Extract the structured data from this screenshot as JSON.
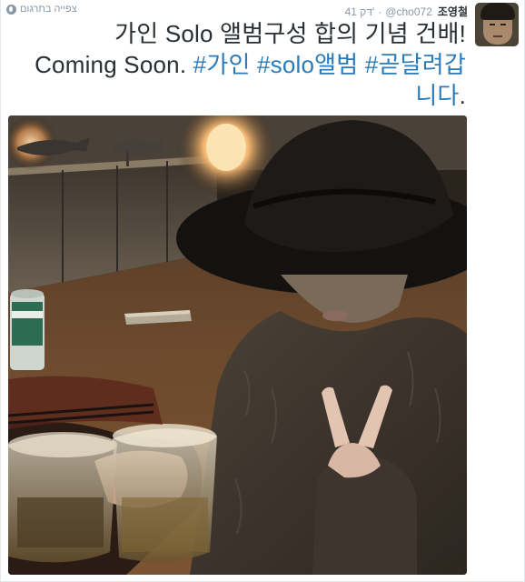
{
  "header": {
    "translate_label": "צפייה בתרגום",
    "time": "41 דק'",
    "dot": "·",
    "screen_name": "@cho072",
    "full_name": "조영철"
  },
  "tweet": {
    "line1": "가인 Solo 앨범구성 합의 기념 건배!",
    "line2_text": "Coming Soon. ",
    "hashtag1": "#가인",
    "hashtag2": "#solo앨범",
    "hashtag3_part1": "#곧달려갑",
    "hashtag3_part2": "니다",
    "line3_end": "."
  },
  "colors": {
    "link": "#2b7bb9",
    "muted": "#8899a6",
    "text": "#292f33"
  },
  "icons": {
    "translate": "globe-icon",
    "avatar": "profile-photo"
  }
}
